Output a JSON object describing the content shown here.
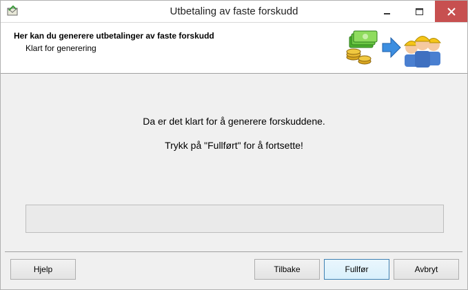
{
  "window": {
    "title": "Utbetaling av faste forskudd",
    "controls": {
      "minimize": "minimize",
      "maximize": "maximize",
      "close": "close"
    }
  },
  "header": {
    "title": "Her kan du generere utbetalinger av faste forskudd",
    "subtitle": "Klart for generering"
  },
  "content": {
    "message_line1": "Da er det klart for å generere forskuddene.",
    "message_line2": "Trykk på \"Fullført\" for å fortsette!"
  },
  "progress": {
    "value": 0
  },
  "buttons": {
    "help": "Hjelp",
    "back": "Tilbake",
    "finish": "Fullfør",
    "cancel": "Avbryt"
  },
  "colors": {
    "close_button": "#c75050",
    "finish_border": "#3c7fb1",
    "dialog_background": "#f0f0f0"
  }
}
